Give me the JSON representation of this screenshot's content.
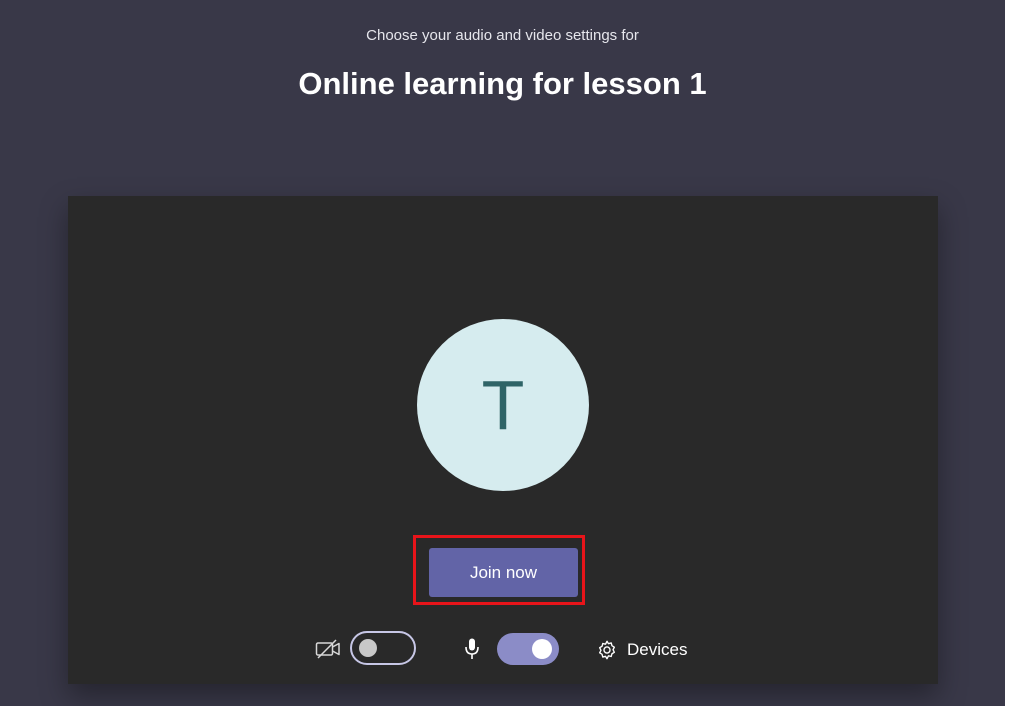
{
  "header": {
    "subtitle": "Choose your audio and video settings for",
    "meeting_title": "Online learning for lesson 1"
  },
  "preview": {
    "avatar_initial": "T",
    "join_label": "Join now"
  },
  "controls": {
    "camera_icon": "camera-off-icon",
    "camera_on": false,
    "mic_icon": "microphone-icon",
    "mic_on": true,
    "devices_icon": "gear-icon",
    "devices_label": "Devices"
  },
  "colors": {
    "background": "#393848",
    "preview_background": "#292929",
    "avatar_background": "#d6ecef",
    "avatar_text": "#2f6467",
    "join_button": "#6264a7",
    "toggle_on": "#8b8cc7",
    "highlight": "#e8141a"
  }
}
